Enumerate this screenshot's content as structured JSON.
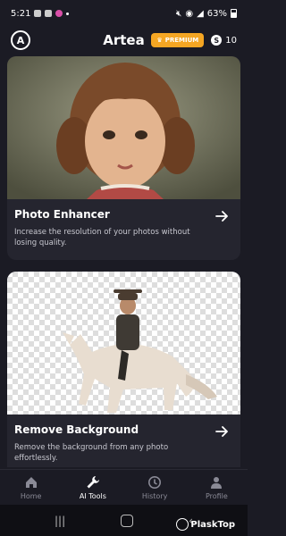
{
  "status": {
    "time": "5:21",
    "battery": "63%"
  },
  "app": {
    "title": "Artea",
    "premium_label": "PREMIUM",
    "credits": "10",
    "coin_symbol": "S"
  },
  "cards": [
    {
      "title": "Photo Enhancer",
      "description": "Increase the resolution of your photos without losing quality."
    },
    {
      "title": "Remove Background",
      "description": "Remove the background from any photo effortlessly."
    }
  ],
  "nav": [
    {
      "label": "Home",
      "icon": "home-icon",
      "active": false
    },
    {
      "label": "AI Tools",
      "icon": "wrench-icon",
      "active": true
    },
    {
      "label": "History",
      "icon": "clock-icon",
      "active": false
    },
    {
      "label": "Profile",
      "icon": "person-icon",
      "active": false
    }
  ],
  "watermark": "PlaskTop",
  "colors": {
    "background": "#1b1b24",
    "card": "#25252f",
    "premium": "#f5a623"
  }
}
